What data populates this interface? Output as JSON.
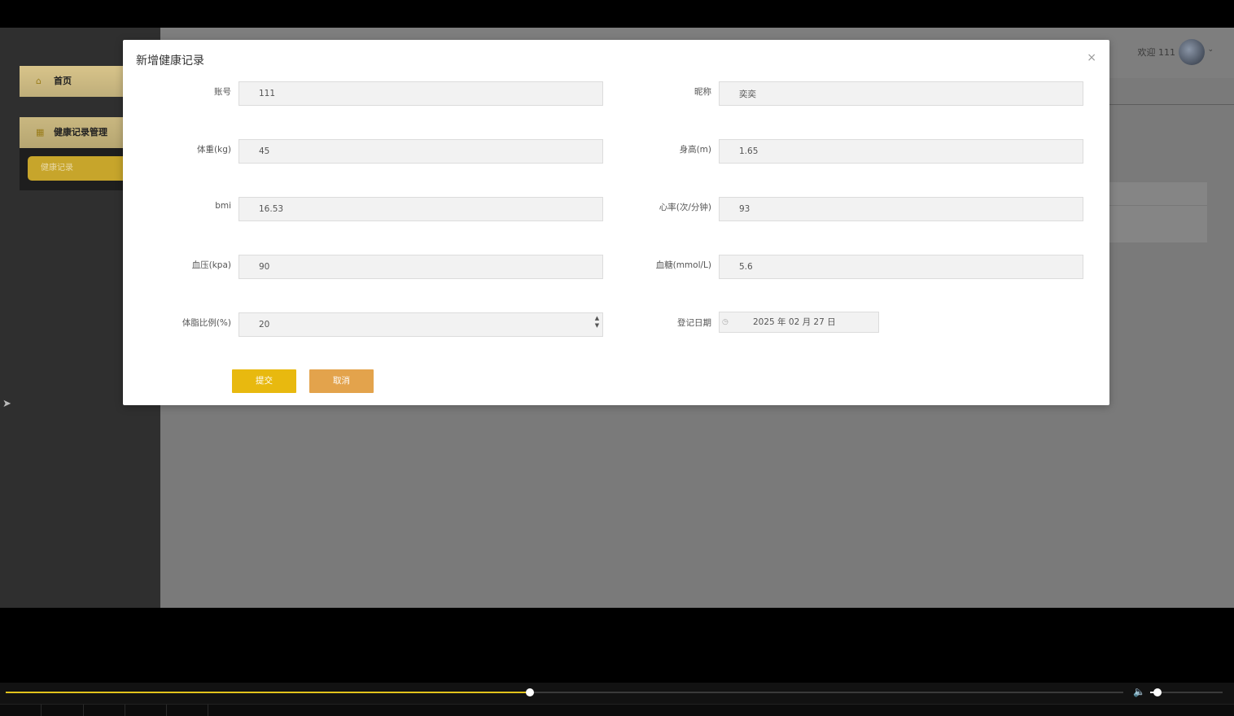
{
  "sidebar": {
    "home_label": "首页",
    "health_menu_label": "健康记录管理",
    "health_sub_label": "健康记录"
  },
  "header": {
    "welcome": "欢迎 111"
  },
  "modal": {
    "title": "新增健康记录",
    "close_symbol": "×",
    "fields": {
      "account": {
        "label": "账号",
        "value": "111"
      },
      "nickname": {
        "label": "昵称",
        "value": "奕奕"
      },
      "weight": {
        "label": "体重(kg)",
        "value": "45"
      },
      "height": {
        "label": "身高(m)",
        "value": "1.65"
      },
      "bmi": {
        "label": "bmi",
        "value": "16.53"
      },
      "heart_rate": {
        "label": "心率(次/分钟)",
        "value": "93"
      },
      "blood_pressure": {
        "label": "血压(kpa)",
        "value": "90"
      },
      "blood_sugar": {
        "label": "血糖(mmol/L)",
        "value": "5.6"
      },
      "body_fat": {
        "label": "体脂比例(%)",
        "value": "20"
      },
      "record_date": {
        "label": "登记日期",
        "value": "2025 年 02 月 27 日"
      }
    },
    "submit_label": "提交",
    "cancel_label": "取消"
  },
  "player": {
    "progress_fraction": 0.469,
    "volume_fraction": 0.1,
    "accent_color": "#e1c21b"
  },
  "colors": {
    "submit_button": "#e8b90f",
    "cancel_button": "#e3a34c",
    "sidebar_active": "#c7a52b"
  }
}
